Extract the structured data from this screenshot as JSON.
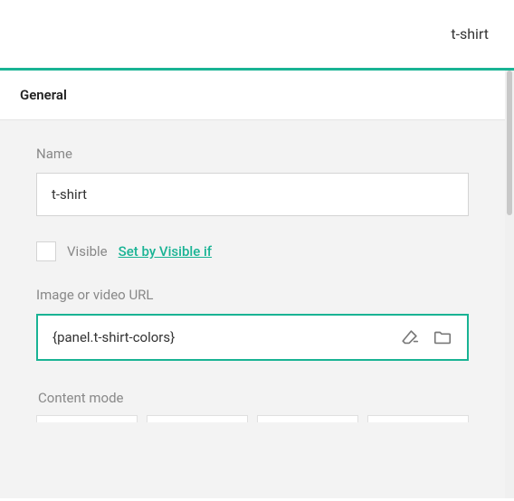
{
  "header": {
    "title": "t-shirt"
  },
  "section": {
    "title": "General"
  },
  "fields": {
    "name": {
      "label": "Name",
      "value": "t-shirt"
    },
    "visible": {
      "label": "Visible",
      "link": "Set by Visible if",
      "checked": false
    },
    "image_url": {
      "label": "Image or video URL",
      "value": "{panel.t-shirt-colors}"
    },
    "content_mode": {
      "label": "Content mode"
    }
  },
  "icons": {
    "clear": "erase-icon",
    "browse": "folder-icon"
  }
}
